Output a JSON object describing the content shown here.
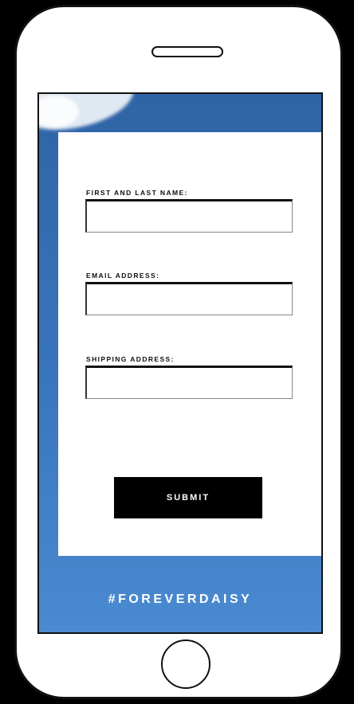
{
  "form": {
    "name_label": "FIRST AND LAST NAME:",
    "name_value": "",
    "email_label": "EMAIL ADDRESS:",
    "email_value": "",
    "shipping_label": "SHIPPING ADDRESS:",
    "shipping_value": "",
    "submit_label": "SUBMIT"
  },
  "footer": {
    "hashtag": "#FOREVERDAISY"
  },
  "colors": {
    "background": "#000000",
    "screen_blue": "#3a76bd",
    "card": "#ffffff",
    "button": "#000000",
    "button_text": "#ffffff"
  },
  "icons": {
    "speaker": "speaker-slot-icon",
    "home": "home-button-icon"
  }
}
